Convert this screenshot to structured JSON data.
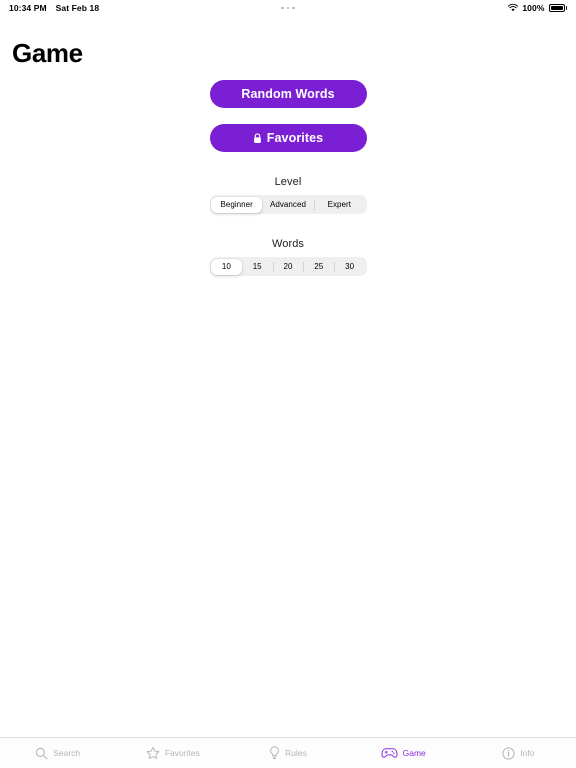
{
  "status_bar": {
    "time": "10:34 PM",
    "date": "Sat Feb 18",
    "battery_percent": "100%",
    "multitask_indicator": "three-dots",
    "wifi_icon": "wifi-icon",
    "battery_icon": "battery-full-icon"
  },
  "header": {
    "title": "Game"
  },
  "main": {
    "buttons": [
      {
        "label": "Random Words",
        "icon": null,
        "name": "random-words-button"
      },
      {
        "label": "Favorites",
        "icon": "lock-icon",
        "name": "favorites-button"
      }
    ],
    "level": {
      "label": "Level",
      "options": [
        "Beginner",
        "Advanced",
        "Expert"
      ],
      "selected": "Beginner",
      "selected_index": 0
    },
    "words": {
      "label": "Words",
      "options": [
        "10",
        "15",
        "20",
        "25",
        "30"
      ],
      "selected": "10",
      "selected_index": 0
    }
  },
  "tab_bar": {
    "items": [
      {
        "label": "Search",
        "icon": "search-icon",
        "active": false
      },
      {
        "label": "Favorites",
        "icon": "star-icon",
        "active": false
      },
      {
        "label": "Rules",
        "icon": "lightbulb-icon",
        "active": false
      },
      {
        "label": "Game",
        "icon": "gamepad-icon",
        "active": true
      },
      {
        "label": "Info",
        "icon": "info-icon",
        "active": false
      }
    ]
  },
  "colors": {
    "accent": "#7b1fd4",
    "tab_active": "#8b2fd8",
    "tab_inactive": "#b5b5b8",
    "segment_track": "#efeff0",
    "background": "#ffffff"
  }
}
